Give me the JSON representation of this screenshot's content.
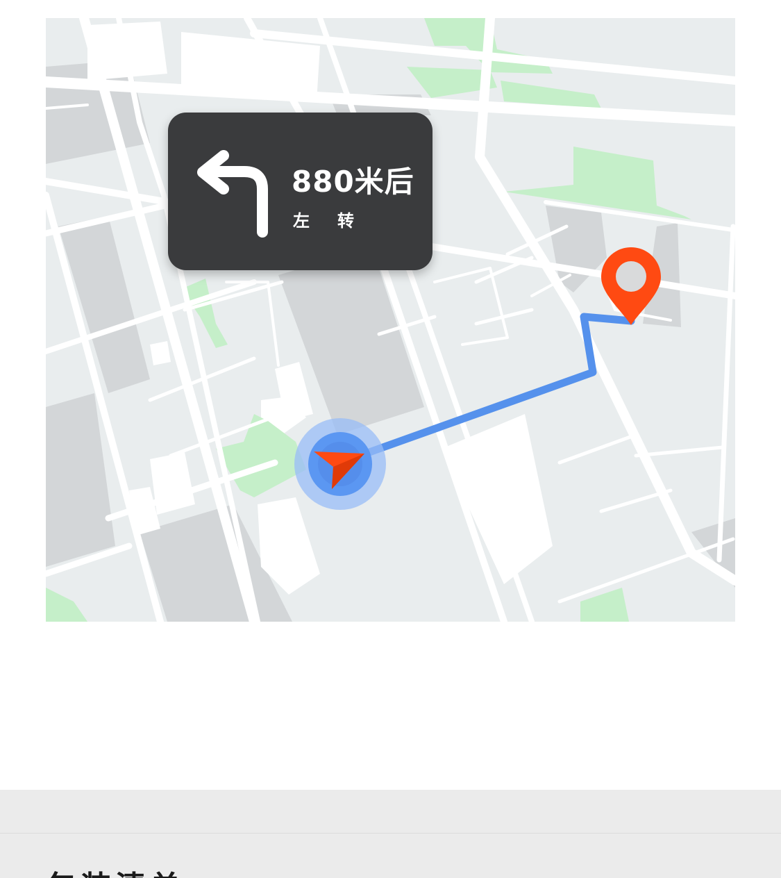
{
  "map": {
    "colors": {
      "background": "#e9edee",
      "block": "#d3d6d8",
      "road": "#ffffff",
      "park": "#c5efc9",
      "route": "#5591ec",
      "destination": "#ff4a12",
      "location_halo": "#98bcf7",
      "location_core": "#5b97f2"
    },
    "icons": {
      "destination": "map-pin-icon",
      "current_location": "navigation-arrow-icon"
    }
  },
  "navigation": {
    "distance": "880米后",
    "instruction": "左转",
    "turn_icon": "turn-left-arrow-icon"
  },
  "section": {
    "title": "包装清单"
  }
}
